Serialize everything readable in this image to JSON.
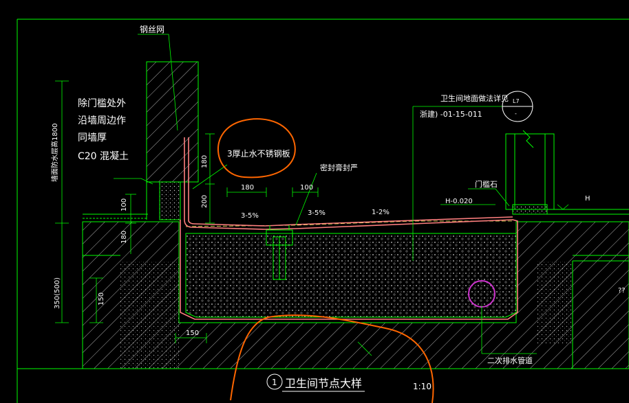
{
  "colors": {
    "background": "#000000",
    "lines": "#00ff00",
    "text": "#ffffff",
    "waterproof_layer": "#ff7f7f",
    "orange_markup": "#ff6600",
    "drain_circle": "#cc33cc",
    "concrete_hatch": "#bfbfbf"
  },
  "labels": {
    "steel_mesh": "钢丝网",
    "note_line1": "除门槛处外",
    "note_line2": "沿墙周边作",
    "note_line3": "同墙厚",
    "note_line4": "C20  混凝土",
    "vertical_note": "墙面防水层高1800",
    "steel_plate": "3厚止水不锈钢板",
    "sealant": "密封膏封严",
    "floor_detail_ref": "卫生间地面做法详见",
    "floor_detail_code": "浙建)  -01-15-011",
    "ref_top": "L7",
    "ref_bottom": "-",
    "threshold_stone": "门槛石",
    "elevation": "H-0.020",
    "elevation_h": "H",
    "secondary_drain": "二次排水管道",
    "title_number": "1",
    "title": "卫生间节点大样",
    "scale": "1:10",
    "right_marks": "??"
  },
  "dimensions": {
    "d180_vertical_top": "180",
    "d200": "200",
    "d100_left": "100",
    "d180_left": "180",
    "d150_left": "150",
    "d350": "350(500)",
    "d180_top": "180",
    "d100_top": "100",
    "d150_bottom": "150"
  },
  "slopes": {
    "slope_left": "3-5%",
    "slope_mid": "3-5%",
    "slope_right": "1-2%"
  }
}
